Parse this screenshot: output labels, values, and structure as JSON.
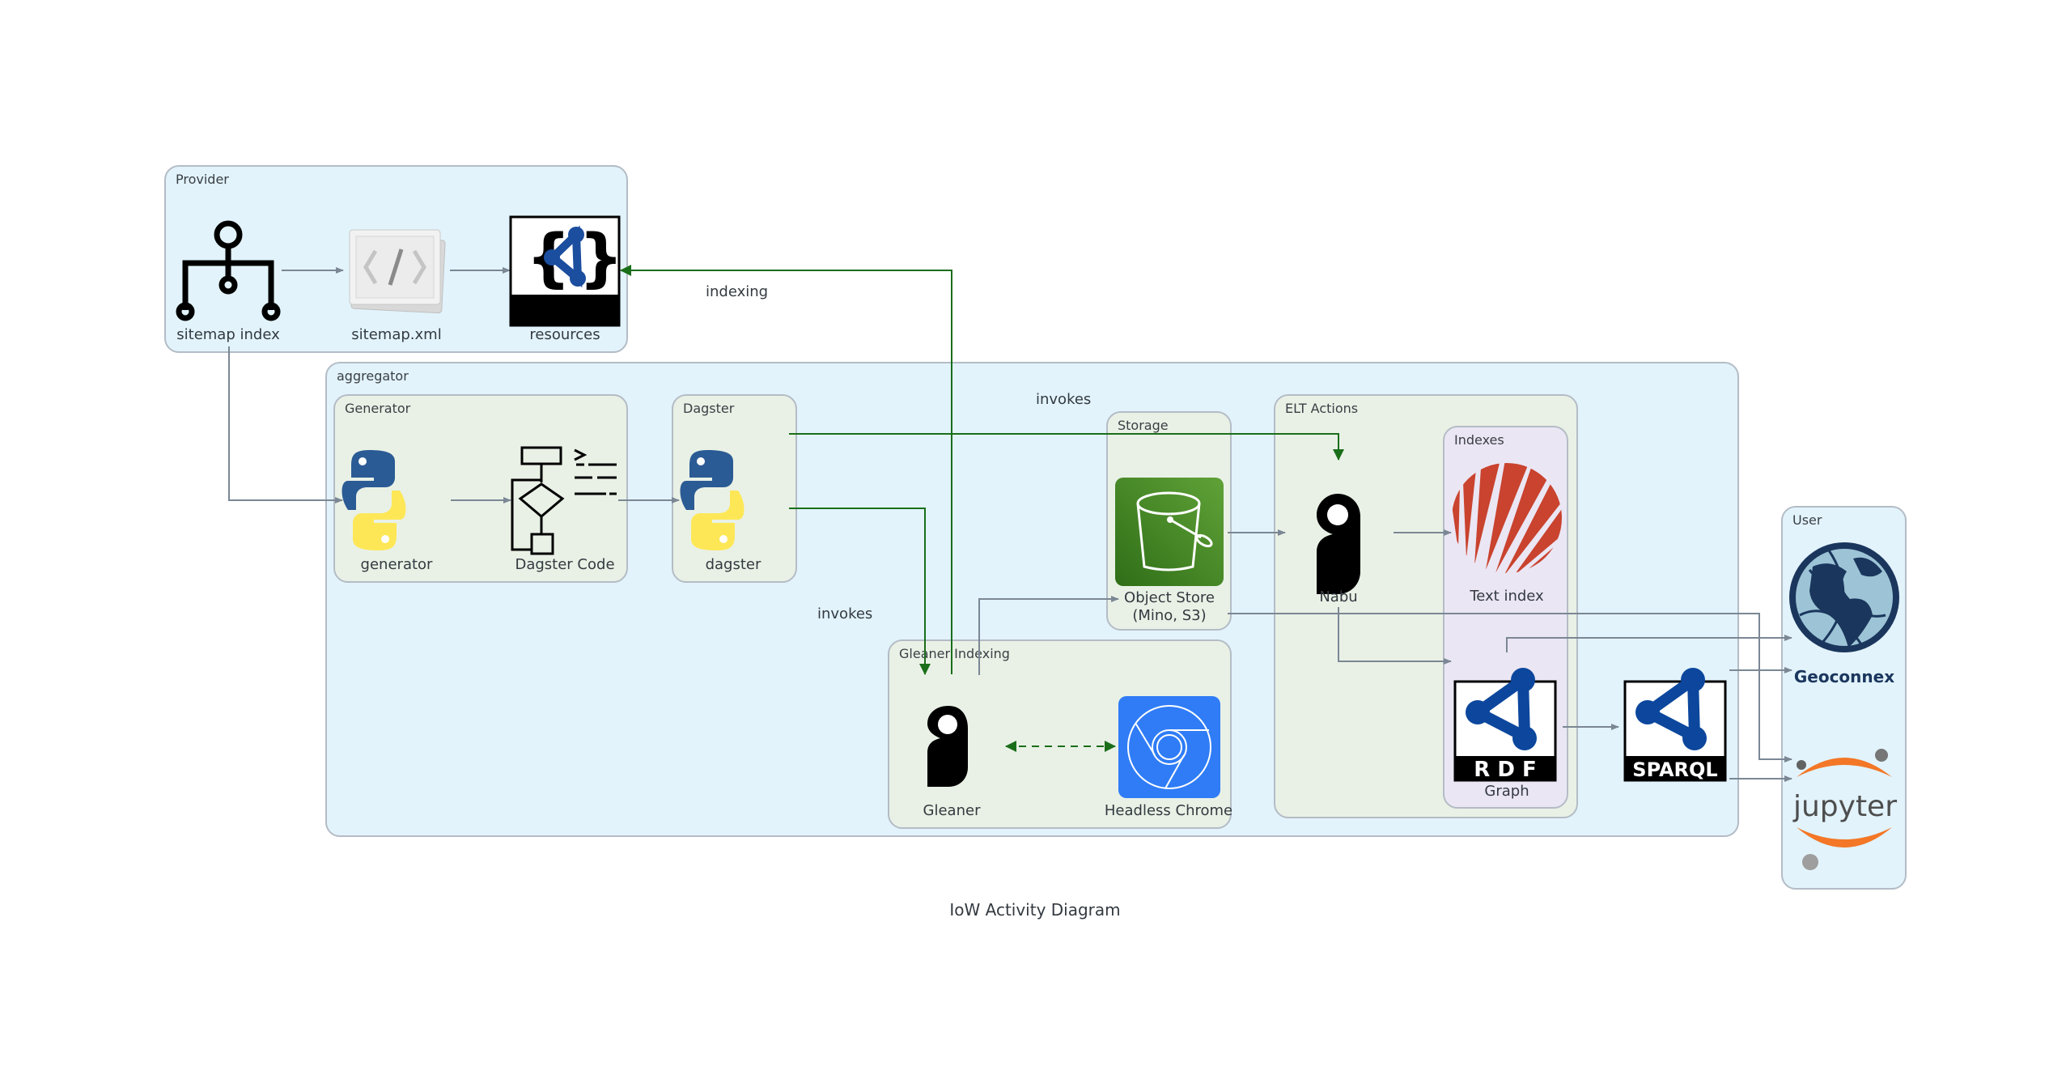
{
  "title": "IoW Activity Diagram",
  "groups": {
    "provider": "Provider",
    "aggregator": "aggregator",
    "generator": "Generator",
    "dagster": "Dagster",
    "storage": "Storage",
    "elt_actions": "ELT Actions",
    "indexes": "Indexes",
    "gleaner_indexing": "Gleaner Indexing",
    "user": "User"
  },
  "nodes": {
    "sitemap_index": "sitemap index",
    "sitemap_xml": "sitemap.xml",
    "resources": "resources",
    "resources_badge": "JSON-LD",
    "generator": "generator",
    "dagster_code": "Dagster Code",
    "dagster": "dagster",
    "object_store_line1": "Object Store",
    "object_store_line2": "(Mino, S3)",
    "nabu": "Nabu",
    "text_index": "Text index",
    "graph": "Graph",
    "graph_badge": "R D F",
    "sparql_badge": "SPARQL",
    "gleaner": "Gleaner",
    "headless_chrome": "Headless Chrome",
    "geoconnex": "Geoconnex",
    "jupyter": "jupyter"
  },
  "edge_labels": {
    "indexing": "indexing",
    "invokes_top": "invokes",
    "invokes_bottom": "invokes"
  },
  "colors": {
    "edge_default": "#7b8794",
    "edge_invoke": "#1a6e1a",
    "group_blue": "#e2f3fb",
    "group_green": "#e9f1e6",
    "group_purple": "#ebe6f4",
    "python_blue": "#2b5b95",
    "python_yellow": "#fde757",
    "s3_green": "#3f8624",
    "chrome_blue": "#2f7cf6",
    "text_index_red": "#c9432e",
    "rdf_blue": "#0c479d",
    "geoconnex_navy": "#1b365d",
    "jupyter_orange": "#f37726"
  }
}
